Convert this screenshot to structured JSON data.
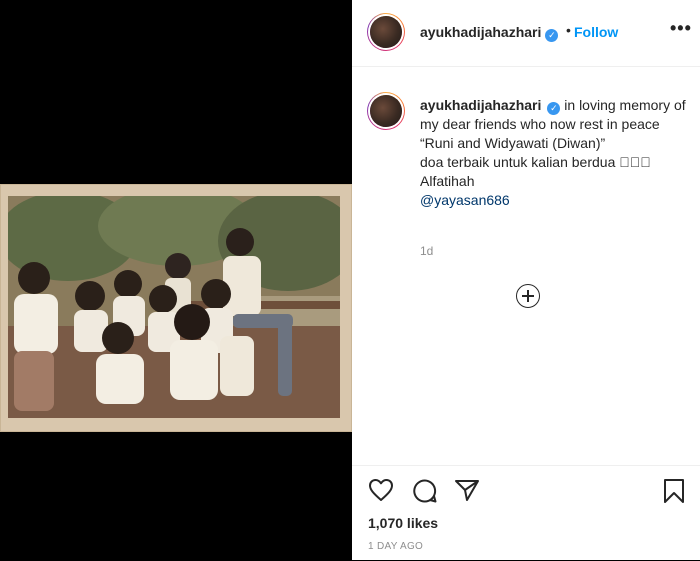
{
  "post": {
    "username": "ayukhadijahazhari",
    "follow_label": "Follow",
    "more_label": "•••",
    "dot": "•",
    "caption_text": "in loving memory of my dear friends who now rest in peace “Runi and Widyawati (Diwan)”",
    "caption_line2": "doa terbaik untuk kalian berdua 🏻🏻🏻",
    "caption_line3": "Alfatihah",
    "mention": "@yayasan686",
    "caption_time": "1d",
    "likes": "1,070 likes",
    "post_time": "1 DAY AGO"
  },
  "icons": {
    "verified": "verified-badge-icon",
    "more": "more-options-icon",
    "add_comment": "plus-circle-icon",
    "like": "heart-icon",
    "comment": "comment-icon",
    "share": "paper-plane-icon",
    "save": "bookmark-icon"
  },
  "colors": {
    "link": "#0095f6",
    "verified": "#3897f0",
    "secondary_text": "#8e8e8e",
    "mention": "#00376b"
  }
}
